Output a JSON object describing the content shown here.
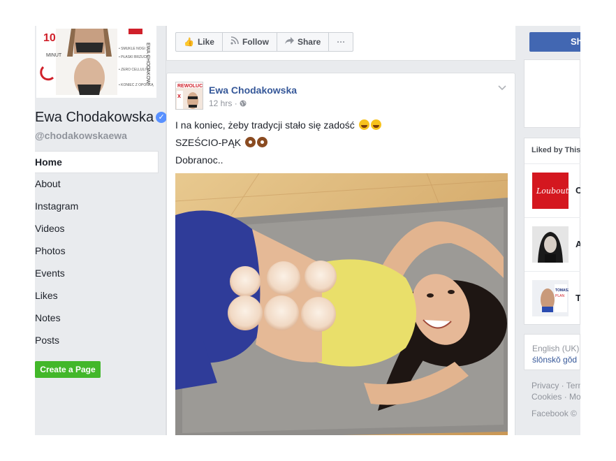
{
  "page": {
    "name": "Ewa Chodakowska",
    "username": "@chodakowskaewa",
    "verified_badge": "✓"
  },
  "nav": {
    "items": [
      {
        "label": "Home"
      },
      {
        "label": "About"
      },
      {
        "label": "Instagram"
      },
      {
        "label": "Videos"
      },
      {
        "label": "Photos"
      },
      {
        "label": "Events"
      },
      {
        "label": "Likes"
      },
      {
        "label": "Notes"
      },
      {
        "label": "Posts"
      }
    ],
    "create_page": "Create a Page"
  },
  "actions": {
    "like": "Like",
    "follow": "Follow",
    "share": "Share",
    "more": "···",
    "share_right": "Sh"
  },
  "post": {
    "author": "Ewa Chodakowska",
    "time": "12 hrs",
    "line1": "I na koniec, żeby tradycji stało się zadość",
    "line2": "SZEŚCIO-PĄK",
    "line3": "Dobranoc.."
  },
  "liked": {
    "title": "Liked by This",
    "items": [
      {
        "letter": "C"
      },
      {
        "letter": "A"
      },
      {
        "letter": "T"
      }
    ]
  },
  "footer": {
    "lang_current": "English (UK)",
    "lang_alt": "ślōnskŏ gŏd",
    "links1": "Privacy · Term",
    "links2": "Cookies · Mo",
    "copyright": "Facebook ©"
  },
  "colors": {
    "link": "#365899",
    "green": "#42b72a",
    "blue_button": "#4267b2",
    "page_bg": "#e9ebee"
  },
  "icons": {
    "like": "thumbs-up-icon",
    "follow": "rss-icon",
    "share": "share-arrow-icon",
    "globe": "globe-icon",
    "chevron": "chevron-down-icon"
  }
}
